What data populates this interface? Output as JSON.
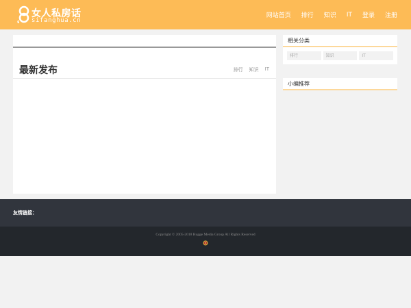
{
  "header": {
    "logo_title": "女人私房话",
    "logo_sub": "sifanghua.cn",
    "nav": [
      "网站首页",
      "排行",
      "知识",
      "IT",
      "登录",
      "注册"
    ]
  },
  "main": {
    "latest_title": "最新发布",
    "tabs": [
      "排行",
      "知识",
      "IT"
    ]
  },
  "sidebar": {
    "categories_title": "相关分类",
    "categories": [
      "排行",
      "知识",
      "IT"
    ],
    "recommend_title": "小编推荐"
  },
  "footer": {
    "links_label": "友情链接：",
    "copyright": "Copyright © 2005-2018 Rugge Media Group All Rights Reserved"
  },
  "colors": {
    "header_bg": "#fdbb56",
    "footer_links_bg": "#31353d",
    "footer_copy_bg": "#23272c",
    "accent_underline": "#fdd89a"
  },
  "icons": {
    "logo": "logo-icon",
    "police_badge": "police-badge-icon"
  }
}
